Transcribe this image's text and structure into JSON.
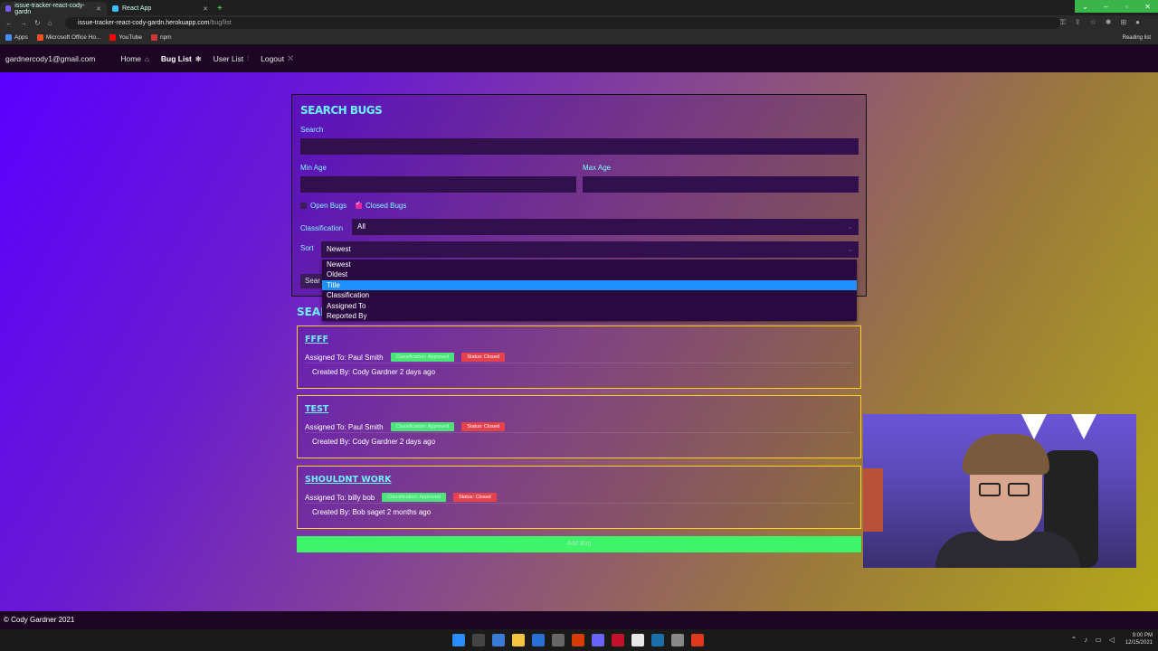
{
  "browser": {
    "tabs": [
      {
        "label": "issue-tracker-react-cody-gardn",
        "active": true
      },
      {
        "label": "React App",
        "active": false
      }
    ],
    "url_host": "issue-tracker-react-cody-gardn.herokuapp.com",
    "url_path": "/bug/list",
    "bookmarks": [
      "Apps",
      "Microsoft Office Ho...",
      "YouTube",
      "npm"
    ],
    "reading_list": "Reading list"
  },
  "nav": {
    "email": "gardnercody1@gmail.com",
    "home": "Home",
    "bug_list": "Bug List",
    "user_list": "User List",
    "logout": "Logout"
  },
  "search": {
    "heading": "SEARCH BUGS",
    "search_label": "Search",
    "search_value": "",
    "min_age_label": "Min Age",
    "max_age_label": "Max Age",
    "open_bugs_label": "Open Bugs",
    "open_bugs_checked": false,
    "closed_bugs_label": "Closed Bugs",
    "closed_bugs_checked": true,
    "classification_label": "Classification",
    "classification_value": "All",
    "sort_label": "Sort",
    "sort_value": "Newest",
    "search_button": "Sear",
    "sort_options": [
      "Newest",
      "Oldest",
      "Title",
      "Classification",
      "Assigned To",
      "Reported By"
    ],
    "highlighted_option": "Title"
  },
  "results": {
    "heading": "SEARC",
    "bugs": [
      {
        "title": "FFFF",
        "assigned": "Assigned To: Paul Smith",
        "classification": "Classification: Approved",
        "status": "Status: Closed",
        "created": "Created By: Cody Gardner 2 days ago"
      },
      {
        "title": "TEST",
        "assigned": "Assigned To: Paul Smith",
        "classification": "Classification: Approved",
        "status": "Status: Closed",
        "created": "Created By: Cody Gardner 2 days ago"
      },
      {
        "title": "SHOULDNT WORK",
        "assigned": "Assigned To: billy bob",
        "classification": "Classification: Approved",
        "status": "Status: Closed",
        "created": "Created By: Bob saget 2 months ago"
      }
    ]
  },
  "add_bug_button": "Add Bug",
  "footer": "© Cody Gardner 2021",
  "clock": {
    "time": "9:00 PM",
    "date": "12/15/2021"
  },
  "colors": {
    "accent": "#6df0ff",
    "card_border": "#ffd21e",
    "add_button": "#3df569",
    "badge_classification": "#4be37a",
    "badge_status": "#e8414e",
    "highlight": "#1e90ff"
  }
}
